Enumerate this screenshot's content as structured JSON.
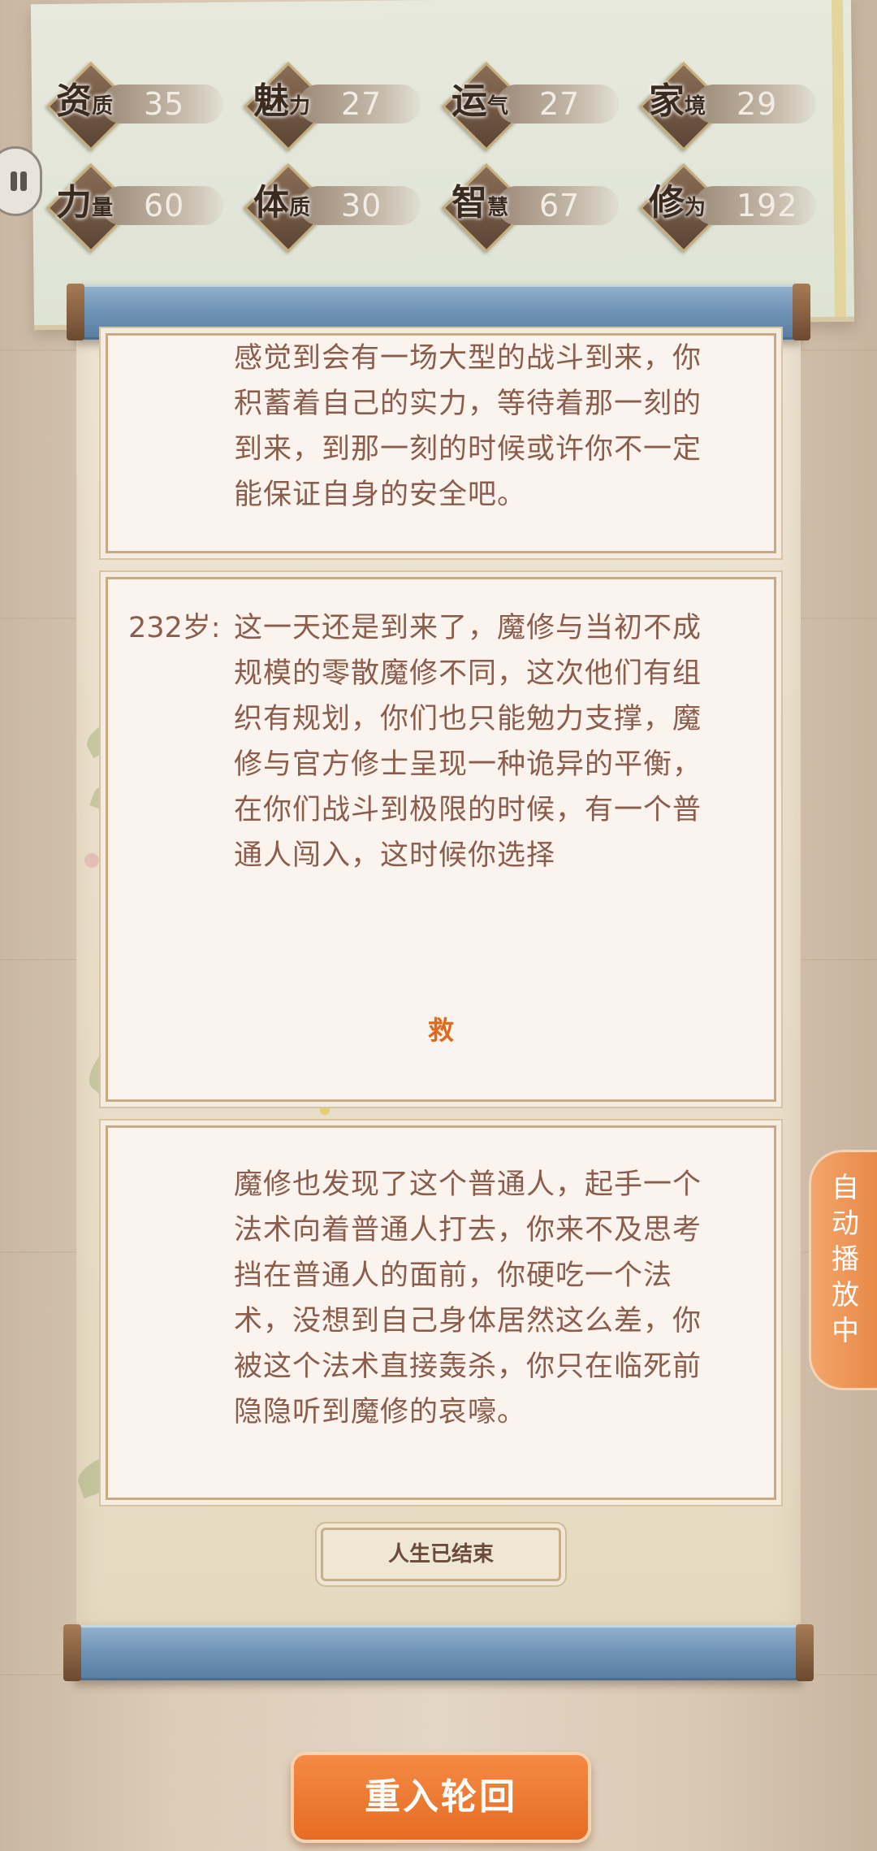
{
  "stats": [
    {
      "big": "资",
      "small": "质",
      "value": "35"
    },
    {
      "big": "魅",
      "small": "力",
      "value": "27"
    },
    {
      "big": "运",
      "small": "气",
      "value": "27"
    },
    {
      "big": "家",
      "small": "境",
      "value": "29"
    },
    {
      "big": "力",
      "small": "量",
      "value": "60"
    },
    {
      "big": "体",
      "small": "质",
      "value": "30"
    },
    {
      "big": "智",
      "small": "慧",
      "value": "67"
    },
    {
      "big": "修",
      "small": "为",
      "value": "192"
    }
  ],
  "events": {
    "prev_text": "感觉到会有一场大型的战斗到来，你积蓄着自己的实力，等待着那一刻的到来，到那一刻的时候或许你不一定能保证自身的安全吧。",
    "current_age": "232岁:",
    "current_text": "这一天还是到来了，魔修与当初不成规模的零散魔修不同，这次他们有组织有规划，你们也只能勉力支撑，魔修与官方修士呈现一种诡异的平衡，在你们战斗到极限的时候，有一个普通人闯入，这时候你选择",
    "choice": "救",
    "result_text": "魔修也发现了这个普通人，起手一个法术向着普通人打去，你来不及思考挡在普通人的面前，你硬吃一个法术，没想到自己身体居然这么差，你被这个法术直接轰杀，你只在临死前隐隐听到魔修的哀嚎。"
  },
  "end_label": "人生已结束",
  "auto_play": [
    "自",
    "动",
    "播",
    "放",
    "中"
  ],
  "rebirth_label": "重入轮回",
  "colors": {
    "accent": "#e66c23",
    "text": "#8a5d4c",
    "rod": "#6f93b5"
  }
}
